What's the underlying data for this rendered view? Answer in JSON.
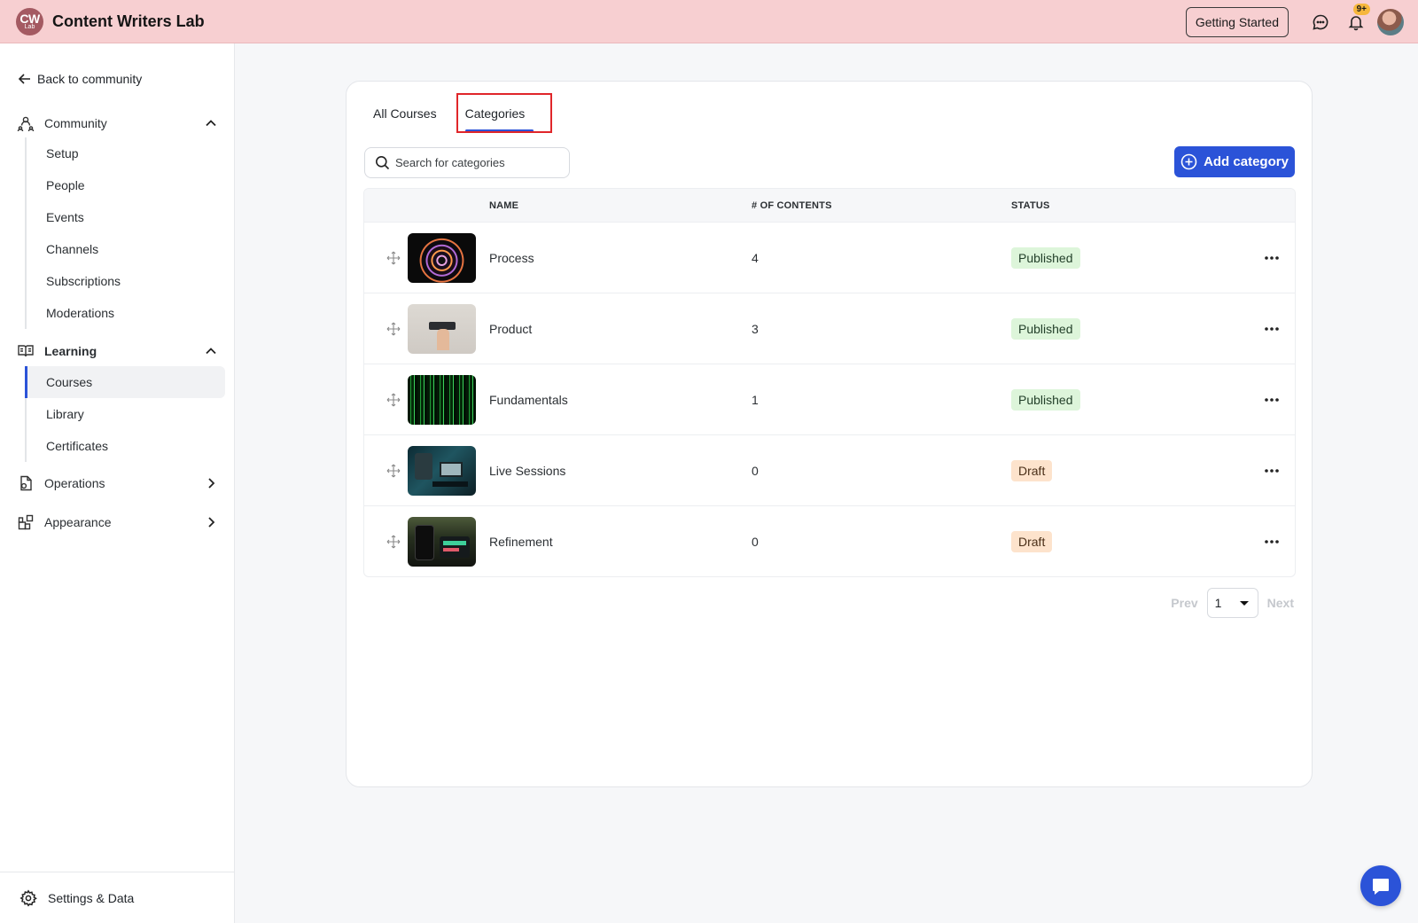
{
  "app": {
    "logo_main": "CW",
    "logo_sub": "Lab",
    "title": "Content Writers Lab"
  },
  "header": {
    "getting_started": "Getting Started",
    "notification_count": "9+"
  },
  "sidebar": {
    "back_label": "Back to community",
    "community": {
      "label": "Community",
      "items": [
        "Setup",
        "People",
        "Events",
        "Channels",
        "Subscriptions",
        "Moderations"
      ]
    },
    "learning": {
      "label": "Learning",
      "items": [
        "Courses",
        "Library",
        "Certificates"
      ],
      "active_item": "Courses"
    },
    "operations_label": "Operations",
    "appearance_label": "Appearance",
    "settings_label": "Settings & Data"
  },
  "tabs": [
    {
      "label": "All Courses",
      "active": false
    },
    {
      "label": "Categories",
      "active": true
    }
  ],
  "search": {
    "placeholder": "Search for categories"
  },
  "add_button": "Add category",
  "table": {
    "headers": {
      "name": "NAME",
      "contents": "# OF CONTENTS",
      "status": "STATUS"
    },
    "rows": [
      {
        "name": "Process",
        "contents": "4",
        "status": "Published",
        "thumb": "spiral"
      },
      {
        "name": "Product",
        "contents": "3",
        "status": "Published",
        "thumb": "hand"
      },
      {
        "name": "Fundamentals",
        "contents": "1",
        "status": "Published",
        "thumb": "matrix"
      },
      {
        "name": "Live Sessions",
        "contents": "0",
        "status": "Draft",
        "thumb": "studio"
      },
      {
        "name": "Refinement",
        "contents": "0",
        "status": "Draft",
        "thumb": "phones"
      }
    ]
  },
  "pagination": {
    "prev": "Prev",
    "page": "1",
    "next": "Next"
  },
  "colors": {
    "header_bg": "#f7cfd1",
    "accent": "#2b53d8",
    "published_bg": "#ddf5da",
    "draft_bg": "#fde3cc",
    "highlight_border": "#e0262a"
  }
}
